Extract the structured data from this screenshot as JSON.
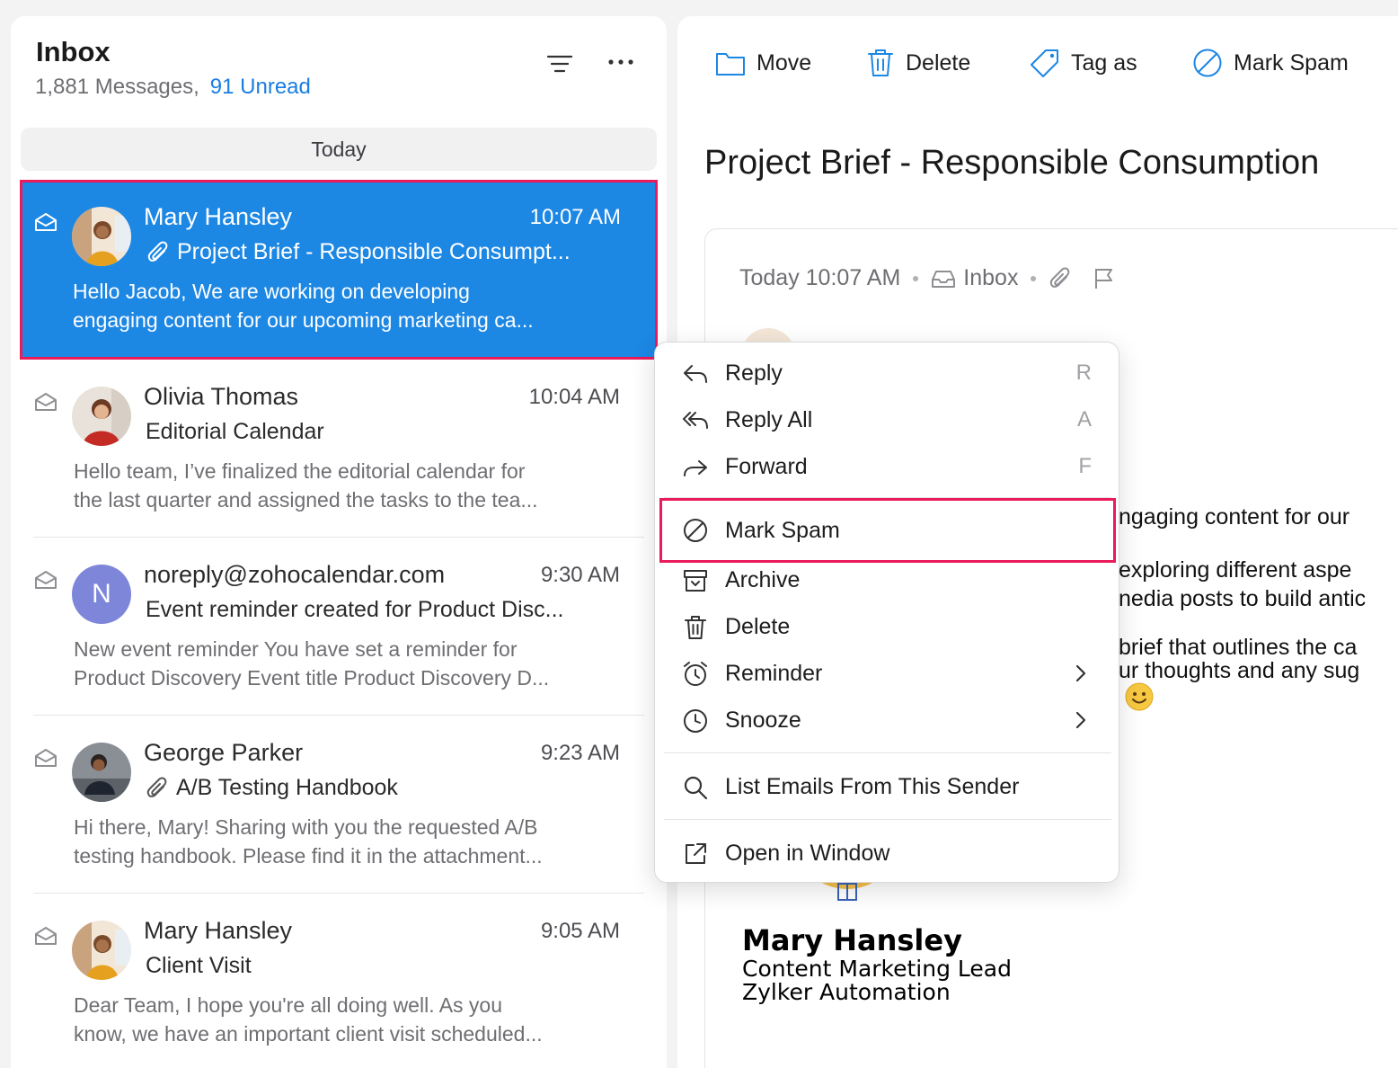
{
  "inbox": {
    "title": "Inbox",
    "count_text": "1,881 Messages,",
    "unread_text": "91 Unread",
    "day_header": "Today"
  },
  "mails": [
    {
      "sender": "Mary Hansley",
      "time": "10:07 AM",
      "subject": "Project Brief - Responsible Consumpt...",
      "preview1": "Hello Jacob, We are working on developing",
      "preview2": "engaging content for our upcoming marketing ca...",
      "attachment": true,
      "selected": true
    },
    {
      "sender": "Olivia Thomas",
      "time": "10:04 AM",
      "subject": "Editorial Calendar",
      "preview1": "Hello team, I’ve finalized the editorial calendar for",
      "preview2": "the last quarter and assigned the tasks to the tea...",
      "attachment": false
    },
    {
      "sender": "noreply@zohocalendar.com",
      "avatar_letter": "N",
      "time": "9:30 AM",
      "subject": "Event reminder created for Product Disc...",
      "preview1": "New event reminder You have set a reminder for",
      "preview2": "Product Discovery Event title Product Discovery D...",
      "attachment": false
    },
    {
      "sender": "George Parker",
      "time": "9:23 AM",
      "subject": "A/B Testing Handbook",
      "preview1": "Hi there, Mary! Sharing with you the requested A/B",
      "preview2": "testing handbook. Please find it in the attachment...",
      "attachment": true
    },
    {
      "sender": "Mary Hansley",
      "time": "9:05 AM",
      "subject": "Client Visit",
      "preview1": "Dear Team, I hope you're all doing well. As you",
      "preview2": "know, we have an important client visit scheduled...",
      "attachment": false
    }
  ],
  "toolbar": {
    "move": "Move",
    "delete": "Delete",
    "tag": "Tag as",
    "spam": "Mark Spam"
  },
  "detail": {
    "subject": "Project Brief - Responsible Consumption",
    "meta_time": "Today 10:07 AM",
    "meta_folder": "Inbox",
    "body": [
      "ngaging content for our",
      " exploring different aspe",
      "nedia posts to build antic",
      "brief that outlines the ca",
      "ur thoughts and any sug"
    ],
    "sig_name": "Mary Hansley",
    "sig_title": "Content Marketing Lead",
    "sig_company": "Zylker Automation"
  },
  "menu": {
    "reply": "Reply",
    "reply_key": "R",
    "reply_all": "Reply All",
    "reply_all_key": "A",
    "forward": "Forward",
    "forward_key": "F",
    "mark_spam": "Mark Spam",
    "archive": "Archive",
    "delete": "Delete",
    "reminder": "Reminder",
    "snooze": "Snooze",
    "list_emails": "List Emails From This Sender",
    "open_window": "Open in Window"
  },
  "colors": {
    "accent": "#1d87e4",
    "highlight_border": "#ea1b5a",
    "unread_link": "#1a7ee0"
  }
}
